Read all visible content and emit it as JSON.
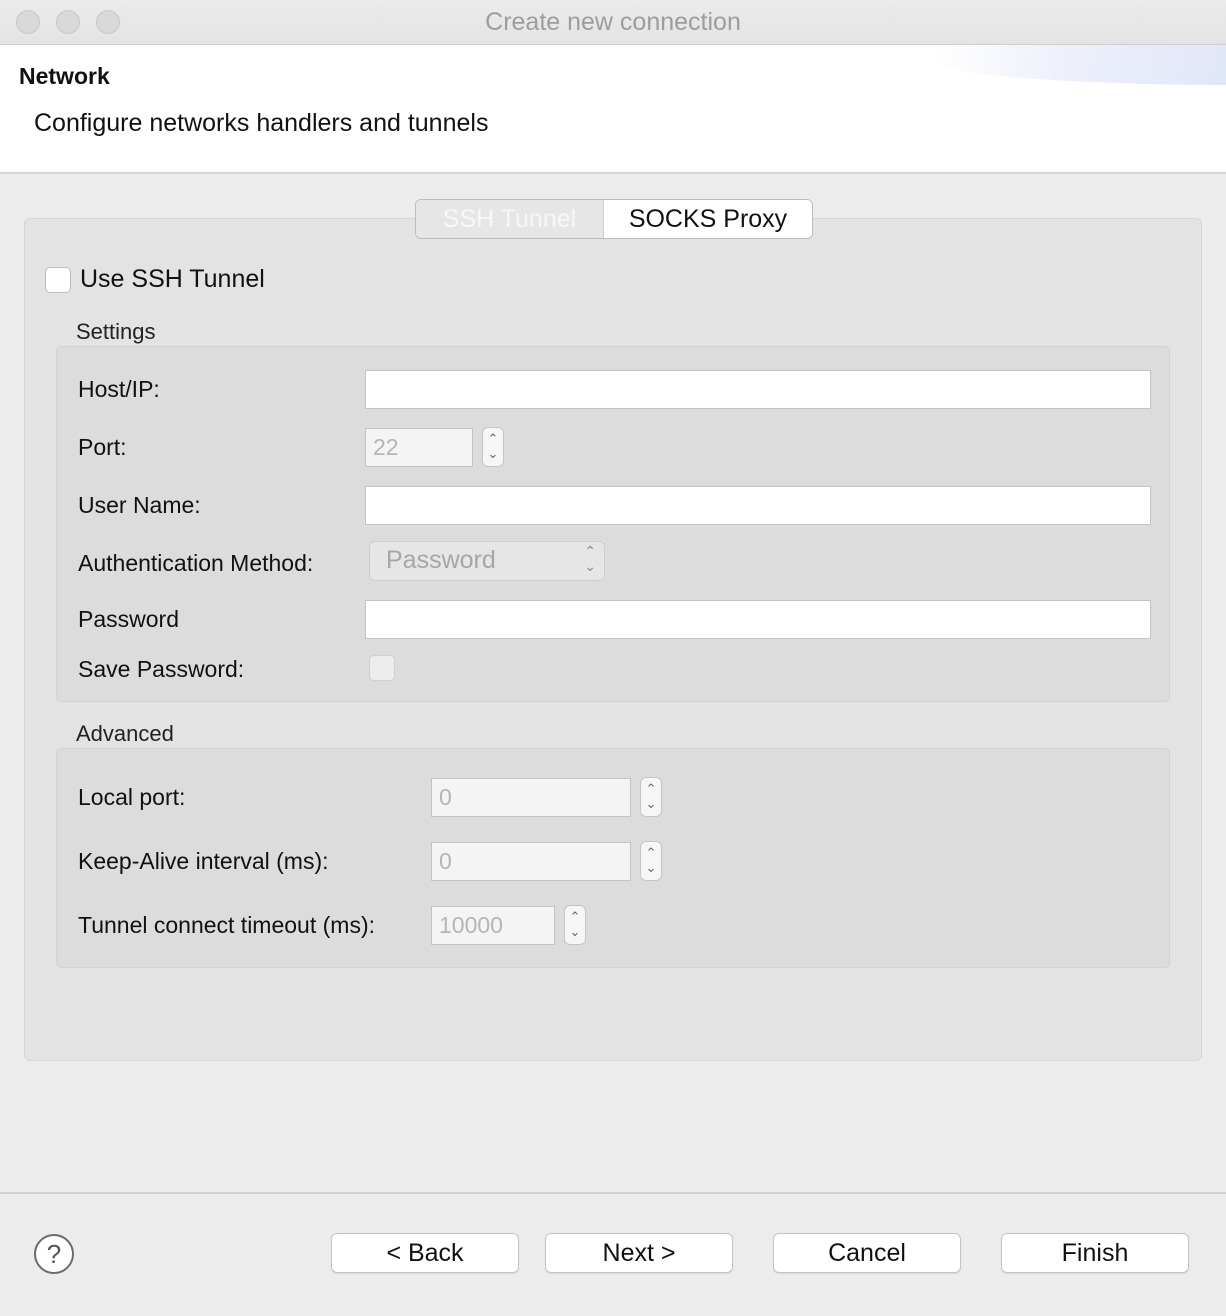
{
  "window": {
    "title": "Create new connection"
  },
  "header": {
    "title": "Network",
    "description": "Configure networks handlers and tunnels"
  },
  "tabs": [
    {
      "label": "SSH Tunnel",
      "selected": false
    },
    {
      "label": "SOCKS Proxy",
      "selected": true
    }
  ],
  "use_ssh_tunnel": {
    "label": "Use SSH Tunnel",
    "checked": false
  },
  "settings": {
    "title": "Settings",
    "host": {
      "label": "Host/IP:",
      "value": ""
    },
    "port": {
      "label": "Port:",
      "value": "22"
    },
    "user": {
      "label": "User Name:",
      "value": ""
    },
    "auth": {
      "label": "Authentication Method:",
      "value": "Password"
    },
    "password": {
      "label": "Password",
      "value": ""
    },
    "save_password": {
      "label": "Save Password:",
      "checked": false
    }
  },
  "advanced": {
    "title": "Advanced",
    "local_port": {
      "label": "Local port:",
      "value": "0"
    },
    "keep_alive": {
      "label": "Keep-Alive interval (ms):",
      "value": "0"
    },
    "timeout": {
      "label": "Tunnel connect timeout (ms):",
      "value": "10000"
    }
  },
  "footer": {
    "back": "< Back",
    "next": "Next >",
    "cancel": "Cancel",
    "finish": "Finish",
    "help": "?"
  },
  "icons": {
    "help": "question-circle-icon",
    "stepper": "chevron-up-down-icon"
  }
}
